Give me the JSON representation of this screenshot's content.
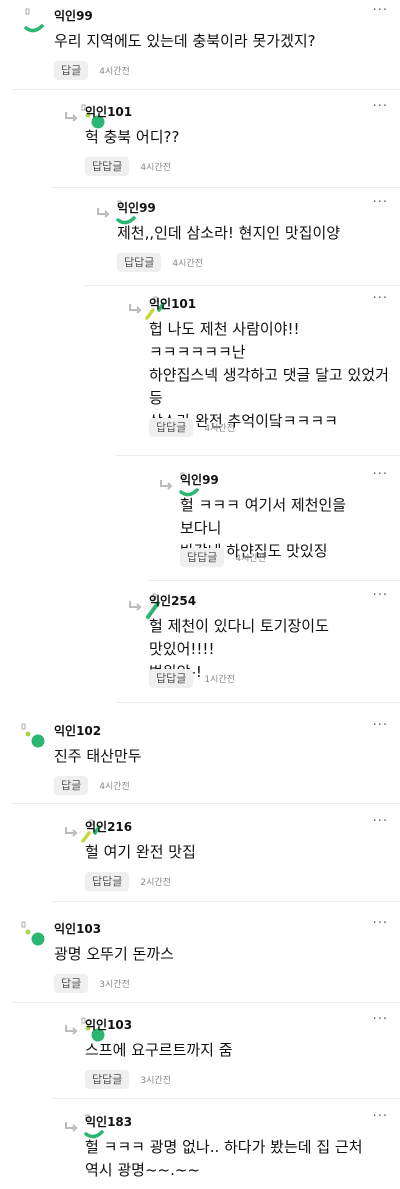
{
  "reply_label": "답글",
  "reply_reply_label": "답답글",
  "more_label": "···",
  "comments": [
    {
      "author": "익인99",
      "text": "우리 지역에도 있는데 충북이라 못가겠지?",
      "time": "4시간전",
      "button": "답글",
      "avatar": "green-arc"
    },
    {
      "author": "익인101",
      "text": "헉 충북 어디??",
      "time": "4시간전",
      "button": "답답글",
      "avatar": "green-dots"
    },
    {
      "author": "익인99",
      "text": "제천,,인데 삼소라! 현지인 맛집이양",
      "time": "4시간전",
      "button": "답답글",
      "avatar": "green-arc"
    },
    {
      "author": "익인101",
      "text": "헙 나도 제천 사람이야!!ㅋㅋㅋㅋㅋㅋ난\n하얀집스넥 생각하고 댓글 달고 있었거\n등\n삼소라 완전 추억이닼ㅋㅋㅋㅋ",
      "time": "4시간전",
      "button": "답답글",
      "avatar": "yellow-green-slashes"
    },
    {
      "author": "익인99",
      "text": "헐 ㅋㅋㅋ 여기서 제천인을 보다니\n반갑네 하얀집도 맛있징",
      "time": "4시간전",
      "button": "답답글",
      "avatar": "green-arc"
    },
    {
      "author": "익인254",
      "text": "헐 제천이 있다니 토기장이도 맛있어!!!!\n법원앞-!",
      "time": "1시간전",
      "button": "답답글",
      "avatar": "green-slash"
    },
    {
      "author": "익인102",
      "text": "진주 태산만두",
      "time": "4시간전",
      "button": "답글",
      "avatar": "green-dots"
    },
    {
      "author": "익인216",
      "text": "헐 여기 완전 맛집",
      "time": "2시간전",
      "button": "답답글",
      "avatar": "yellow-green-slashes"
    },
    {
      "author": "익인103",
      "text": "광명 오뚜기 돈까스",
      "time": "3시간전",
      "button": "답글",
      "avatar": "green-dots"
    },
    {
      "author": "익인103",
      "text": "스프에 요구르트까지 줌",
      "time": "3시간전",
      "button": "답답글",
      "avatar": "green-dots"
    },
    {
      "author": "익인183",
      "text": "헐 ㅋㅋㅋ 광명 없나.. 하다가 봤는데 집 근처\n역시 광명~~.~~",
      "time": "",
      "button": "",
      "avatar": "green-arc"
    }
  ]
}
